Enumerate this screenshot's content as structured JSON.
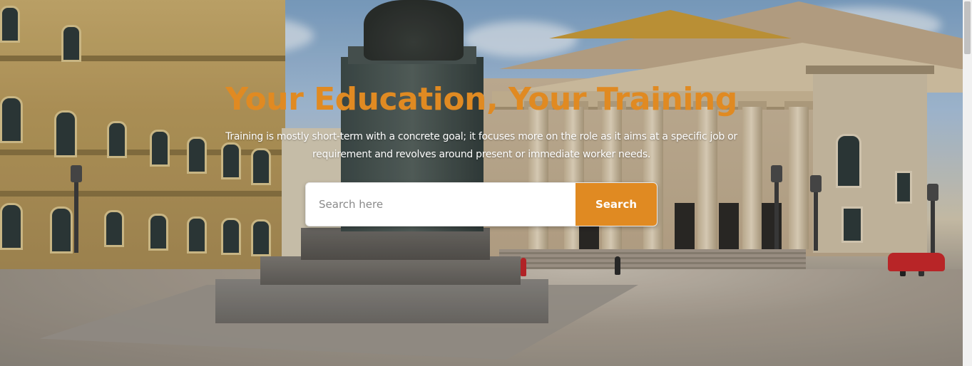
{
  "hero": {
    "title": "Your Education, Your Training",
    "subtitle": "Training is mostly short-term with a concrete goal; it focuses more on the role as it aims at a specific job or requirement and revolves around present or immediate worker needs.",
    "background_image": "opera-house-plaza-with-statue"
  },
  "search": {
    "placeholder": "Search here",
    "value": "",
    "button_label": "Search"
  },
  "colors": {
    "accent": "#e08a22",
    "subtitle_text": "#ffffff",
    "search_bg": "#ffffff"
  },
  "scrollbar": {
    "position_fraction": 0.0
  }
}
